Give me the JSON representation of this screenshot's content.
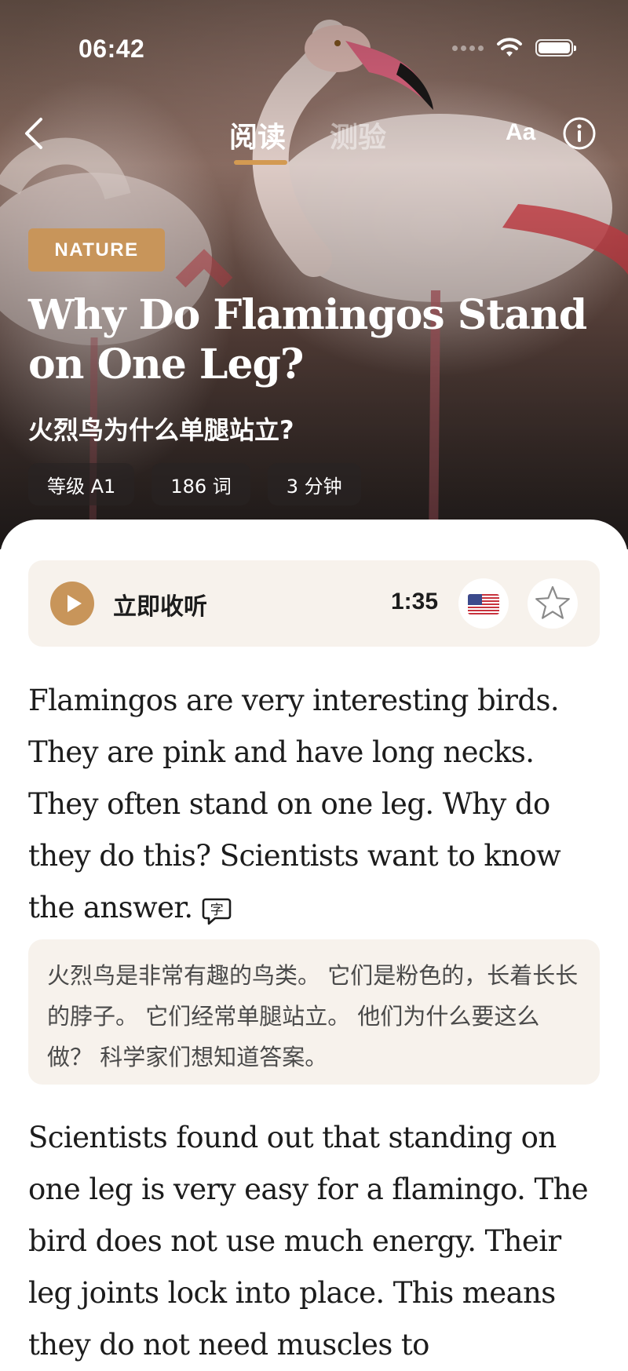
{
  "status_bar": {
    "time": "06:42"
  },
  "nav": {
    "tabs": [
      {
        "label": "阅读",
        "active": true
      },
      {
        "label": "测验",
        "active": false
      }
    ],
    "font_button": "Aa"
  },
  "article": {
    "category": "NATURE",
    "title": "Why Do Flamingos Stand on One Leg?",
    "subtitle": "火烈鸟为什么单腿站立?",
    "meta": {
      "level": "等级 A1",
      "words": "186 词",
      "minutes": "3 分钟"
    }
  },
  "audio": {
    "label": "立即收听",
    "duration": "1:35",
    "accent_flag": "us-flag-icon"
  },
  "body": {
    "paragraph1": "Flamingos are very interesting birds. They are pink and have long necks. They often stand on one leg. Why do they do this? Scientists want to know the answer.",
    "translation1": "火烈鸟是非常有趣的鸟类。 它们是粉色的，长着长长的脖子。 它们经常单腿站立。 他们为什么要这么做？ 科学家们想知道答案。",
    "paragraph2": "Scientists found out that standing on one leg is very easy for a flamingo. The bird does not use much energy. Their leg joints lock into place. This means they do not need muscles to"
  },
  "colors": {
    "accent": "#c8955a",
    "tab_underline": "#d39a52",
    "panel_bg": "#f7f2ec",
    "text": "#1c1c1c"
  }
}
